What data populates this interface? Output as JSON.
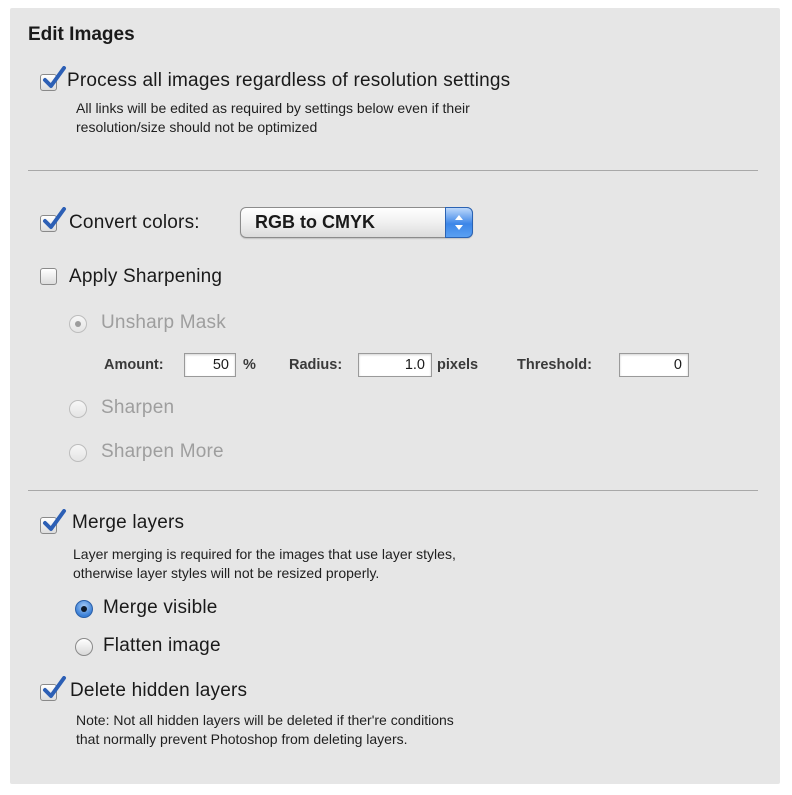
{
  "section": {
    "title": "Edit Images"
  },
  "process_all": {
    "label": "Process all images regardless of resolution settings",
    "checked": true,
    "note_line1": "All links will be edited as required by settings below even if their",
    "note_line2": "resolution/size should not be optimized"
  },
  "convert_colors": {
    "label": "Convert colors:",
    "checked": true,
    "selected": "RGB to CMYK"
  },
  "sharpening": {
    "label": "Apply Sharpening",
    "checked": false,
    "options": [
      "Unsharp Mask",
      "Sharpen",
      "Sharpen More"
    ],
    "selected": "Unsharp Mask",
    "amount_label": "Amount:",
    "amount_value": "50",
    "amount_unit": "%",
    "radius_label": "Radius:",
    "radius_value": "1.0",
    "radius_unit": "pixels",
    "threshold_label": "Threshold:",
    "threshold_value": "0"
  },
  "merge_layers": {
    "label": "Merge layers",
    "checked": true,
    "note_line1": "Layer merging is required for the images that use layer styles,",
    "note_line2": "otherwise layer styles will not be resized properly.",
    "options": [
      "Merge visible",
      "Flatten image"
    ],
    "selected": "Merge visible"
  },
  "delete_hidden": {
    "label": "Delete hidden layers",
    "checked": true,
    "note_line1": "Note: Not all hidden layers will be deleted if ther're conditions",
    "note_line2": "that normally prevent Photoshop from deleting layers."
  },
  "colors": {
    "panel_bg": "#e6e6e6",
    "accent_blue": "#2f6fd0",
    "disabled_text": "#9e9e9e"
  }
}
